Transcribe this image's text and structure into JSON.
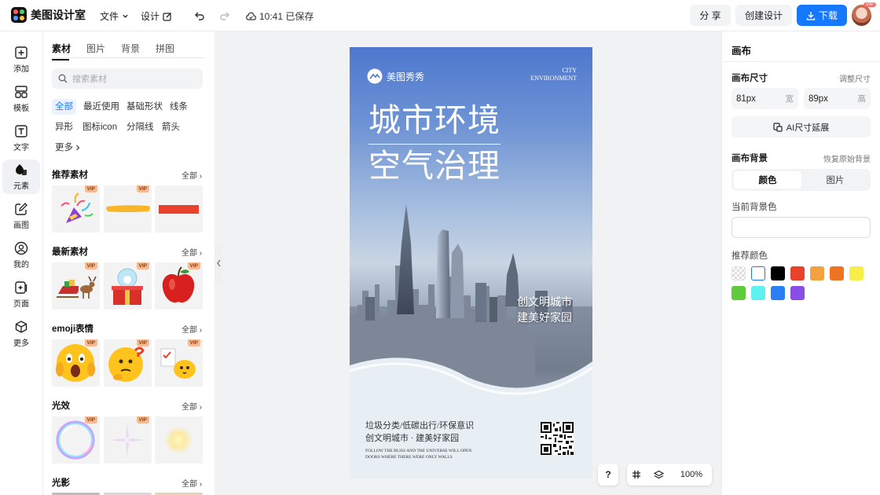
{
  "app": {
    "name": "美图设计室"
  },
  "menu": {
    "file": "文件",
    "design": "设计"
  },
  "save_status": "10:41 已保存",
  "actions": {
    "share": "分 享",
    "create": "创建设计",
    "download": "下载"
  },
  "avatar": {
    "badge": "VIP"
  },
  "rail": [
    {
      "label": "添加",
      "icon": "plus-square-icon"
    },
    {
      "label": "模板",
      "icon": "template-grid-icon"
    },
    {
      "label": "文字",
      "icon": "text-box-icon"
    },
    {
      "label": "元素",
      "icon": "shapes-icon",
      "active": true
    },
    {
      "label": "画图",
      "icon": "pencil-edit-icon"
    },
    {
      "label": "我的",
      "icon": "user-icon"
    },
    {
      "label": "页面",
      "icon": "page-add-icon"
    },
    {
      "label": "更多",
      "icon": "cube-icon"
    }
  ],
  "panel": {
    "tabs": [
      "素材",
      "图片",
      "背景",
      "拼图"
    ],
    "search_placeholder": "搜索素材",
    "chips": [
      "全部",
      "最近使用",
      "基础形状",
      "线条",
      "异形",
      "图标icon",
      "分隔线",
      "箭头",
      "更多"
    ],
    "sections": [
      {
        "title": "推荐素材",
        "all": "全部",
        "vip": [
          "VIP",
          "VIP"
        ]
      },
      {
        "title": "最新素材",
        "all": "全部",
        "vip": [
          "VIP",
          "VIP",
          "VIP"
        ]
      },
      {
        "title": "emoji表情",
        "all": "全部",
        "vip": [
          "VIP",
          "VIP",
          "VIP"
        ]
      },
      {
        "title": "光效",
        "all": "全部",
        "vip": [
          "VIP",
          "VIP"
        ]
      },
      {
        "title": "光影",
        "all": "全部",
        "vip": []
      }
    ]
  },
  "poster": {
    "brand": "美图秀秀",
    "city_en_1": "CITY",
    "city_en_2": "ENVIRONMENT",
    "title_1": "城市环境",
    "title_2": "空气治理",
    "slogan_1": "创文明城市",
    "slogan_2": "建美好家园",
    "footer_1": "垃圾分类/低碳出行/环保意识",
    "footer_2": "创文明城市 · 建美好家园",
    "footer_en_1": "FOLLOW THE BLISS AND THE UNIVERSE WILL OPEN",
    "footer_en_2": "DOORS WHERE THERE WERE ONLY WALLS"
  },
  "canvas_tools": {
    "help": "?",
    "zoom": "100%"
  },
  "right_panel": {
    "title": "画布",
    "size_label": "画布尺寸",
    "size_link": "调整尺寸",
    "width": {
      "value": "81px",
      "unit": "宽"
    },
    "height": {
      "value": "89px",
      "unit": "高"
    },
    "ai_extend": "AI尺寸延展",
    "bg_label": "画布背景",
    "bg_reset": "恢复原始背景",
    "bg_tabs": [
      "颜色",
      "图片"
    ],
    "current_color_label": "当前背景色",
    "recommend_label": "推荐颜色",
    "swatches": [
      "transparent",
      "#ffffff",
      "#000000",
      "#e8412c",
      "#f4a142",
      "#ee7424",
      "#f8ee4a",
      "#5fcb3c",
      "#5ff0f0",
      "#2a7ff5",
      "#8a4ee8"
    ]
  }
}
